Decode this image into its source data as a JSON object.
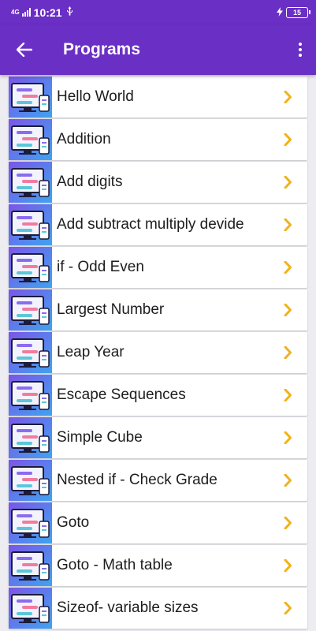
{
  "status_bar": {
    "network": "4G",
    "time": "10:21",
    "battery": "15"
  },
  "app_bar": {
    "title": "Programs"
  },
  "colors": {
    "primary": "#6a2fc4",
    "chevron": "#f0b21a"
  },
  "programs": [
    {
      "label": "Hello World"
    },
    {
      "label": "Addition"
    },
    {
      "label": "Add digits"
    },
    {
      "label": "Add subtract multiply devide"
    },
    {
      "label": "if - Odd Even"
    },
    {
      "label": "Largest Number"
    },
    {
      "label": "Leap Year"
    },
    {
      "label": "Escape Sequences"
    },
    {
      "label": "Simple Cube"
    },
    {
      "label": "Nested if - Check Grade"
    },
    {
      "label": "Goto"
    },
    {
      "label": "Goto - Math table"
    },
    {
      "label": "Sizeof- variable sizes"
    }
  ]
}
